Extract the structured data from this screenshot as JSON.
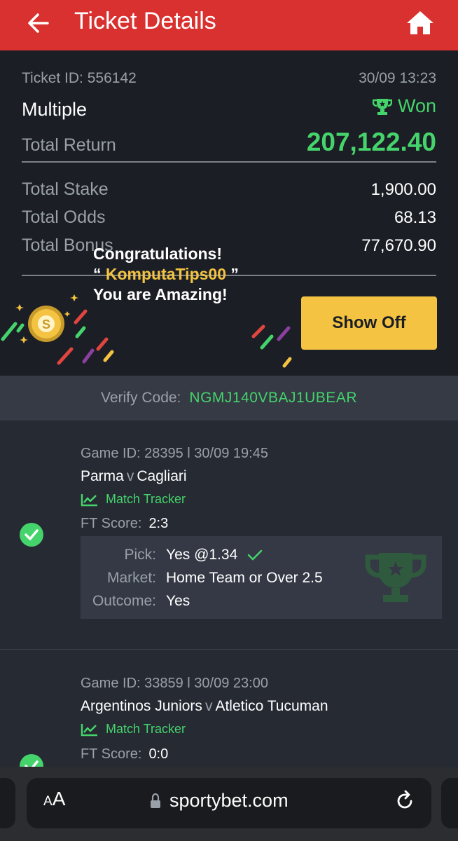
{
  "header": {
    "title": "Ticket Details"
  },
  "summary": {
    "ticket_id": "Ticket ID: 556142",
    "date": "30/09 13:23",
    "type": "Multiple",
    "status": "Won",
    "total_return_label": "Total Return",
    "total_return": "207,122.40",
    "stake_label": "Total Stake",
    "stake": "1,900.00",
    "odds_label": "Total Odds",
    "odds": "68.13",
    "bonus_label": "Total Bonus",
    "bonus": "77,670.90"
  },
  "banner": {
    "line1": "Congratulations!",
    "quote_open": "“ ",
    "username": "KomputaTips00",
    "quote_close": " ”",
    "line3": "You are Amazing!",
    "button": "Show Off"
  },
  "verify": {
    "label": "Verify Code:",
    "code": "NGMJ140VBAJ1UBEAR"
  },
  "games": [
    {
      "meta": "Game ID: 28395 l 30/09 19:45",
      "home": "Parma",
      "vs": "v",
      "away": "Cagliari",
      "tracker": "Match Tracker",
      "ft_label": "FT Score:",
      "ft_score": "2:3",
      "pick_label": "Pick:",
      "pick": "Yes @1.34",
      "market_label": "Market:",
      "market": "Home Team or Over 2.5",
      "outcome_label": "Outcome:",
      "outcome": "Yes"
    },
    {
      "meta": "Game ID: 33859 l 30/09 23:00",
      "home": "Argentinos Juniors",
      "vs": "v",
      "away": "Atletico Tucuman",
      "tracker": "Match Tracker",
      "ft_label": "FT Score:",
      "ft_score": "0:0"
    }
  ],
  "browser": {
    "aa_small": "A",
    "aa_large": "A",
    "url": "sportybet.com"
  },
  "colors": {
    "brand_red": "#d8312f",
    "win_green": "#45d36b",
    "gold": "#f3c341"
  },
  "icons": [
    "back-arrow-icon",
    "home-icon",
    "trophy-icon",
    "coin-icon",
    "chart-icon",
    "check-icon",
    "lock-icon",
    "reload-icon"
  ]
}
